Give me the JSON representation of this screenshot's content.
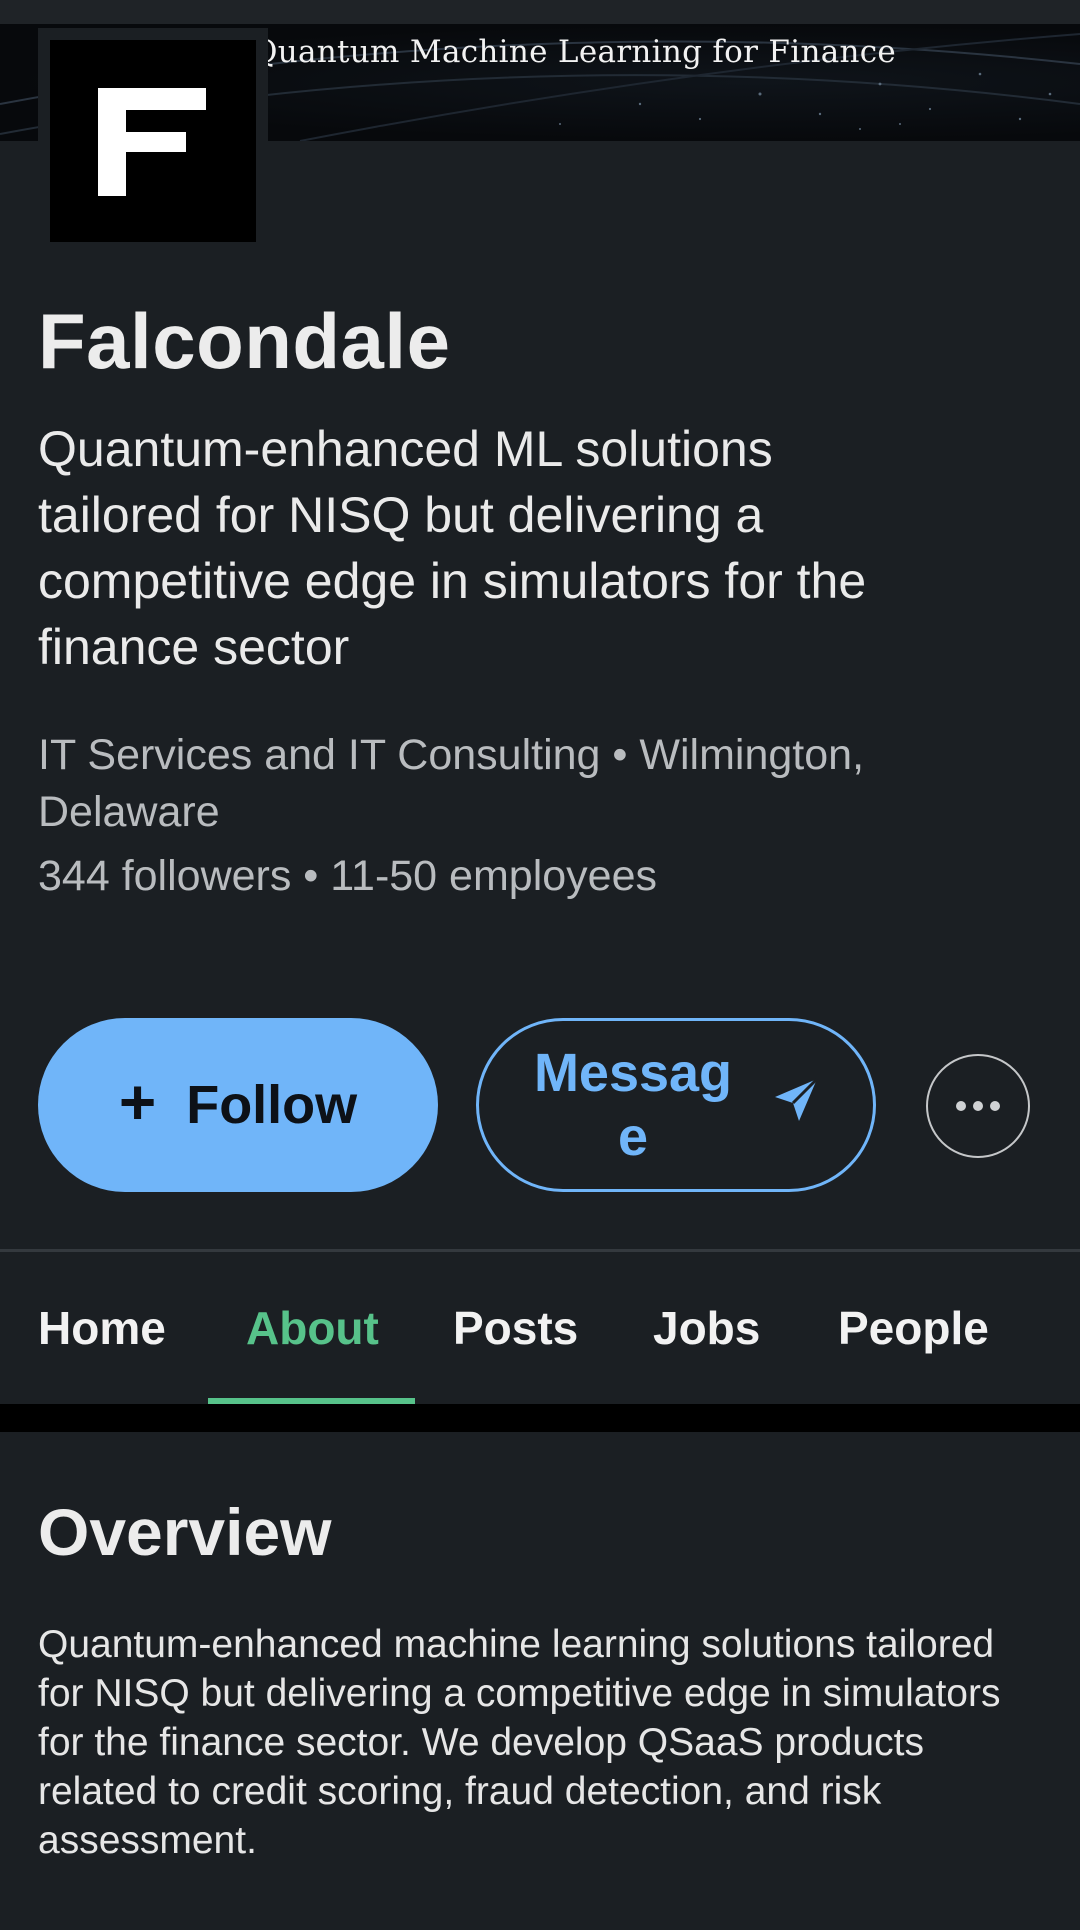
{
  "banner": {
    "title": "Quantum Machine Learning for Finance"
  },
  "company": {
    "name": "Falcondale",
    "tagline": "Quantum-enhanced ML solutions tailored for NISQ but delivering a competitive edge in simulators for the finance sector",
    "industry_location": "IT Services and IT Consulting • Wilmington, Delaware",
    "followers_employees": "344 followers • 11-50 employees"
  },
  "actions": {
    "follow_label": "Follow",
    "follow_icon": "plus-icon",
    "message_label": "Message",
    "message_icon": "send-icon",
    "more_icon": "more-options-icon"
  },
  "tabs": [
    {
      "label": "Home",
      "active": false
    },
    {
      "label": "About",
      "active": true
    },
    {
      "label": "Posts",
      "active": false
    },
    {
      "label": "Jobs",
      "active": false
    },
    {
      "label": "People",
      "active": false
    }
  ],
  "overview": {
    "title": "Overview",
    "text": "Quantum-enhanced machine learning solutions tailored for NISQ but delivering a competitive edge in simulators for the finance sector. We develop QSaaS products related to credit scoring, fraud detection, and risk assessment."
  },
  "colors": {
    "background": "#1b1f23",
    "primary_button": "#70b5f9",
    "active_tab": "#57c28a"
  }
}
